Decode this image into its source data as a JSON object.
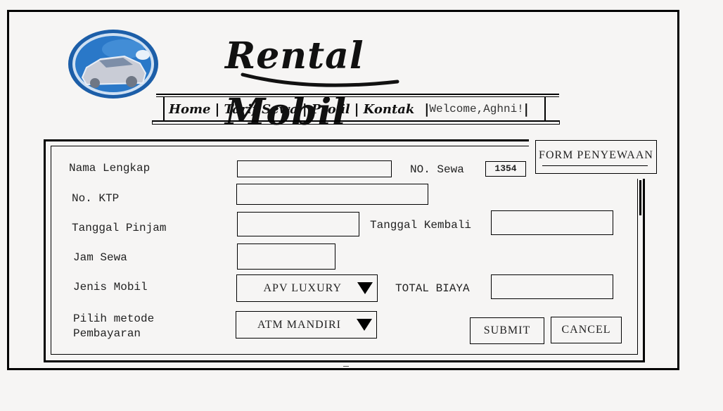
{
  "brand": {
    "title": "Rental Mobil",
    "logo_icon": "car-logo-icon"
  },
  "nav": {
    "links": [
      "Home",
      "Tarif Sewa",
      "Profil",
      "Kontak"
    ],
    "separator": "|",
    "welcome": "Welcome,Aghni!"
  },
  "form": {
    "title": "FORM PENYEWAAN",
    "fields": {
      "nama_lengkap": {
        "label": "Nama Lengkap",
        "value": ""
      },
      "no_ktp": {
        "label": "No. KTP",
        "value": ""
      },
      "tanggal_pinjam": {
        "label": "Tanggal Pinjam",
        "value": ""
      },
      "tanggal_kembali": {
        "label": "Tanggal Kembali",
        "value": ""
      },
      "jam_sewa": {
        "label": "Jam Sewa",
        "value": ""
      },
      "total_biaya": {
        "label": "TOTAL BIAYA",
        "value": ""
      },
      "no_sewa": {
        "label": "NO. Sewa",
        "value": "1354"
      }
    },
    "jenis_mobil": {
      "label": "Jenis Mobil",
      "selected": "APV LUXURY"
    },
    "metode_pembayaran": {
      "label_line1": "Pilih metode",
      "label_line2": "Pembayaran",
      "selected": "ATM MANDIRI"
    },
    "buttons": {
      "submit": "SUBMIT",
      "cancel": "CANCEL"
    }
  },
  "colors": {
    "background": "#f6f5f4",
    "border": "#000000",
    "logo_blue": "#1e63b8"
  }
}
